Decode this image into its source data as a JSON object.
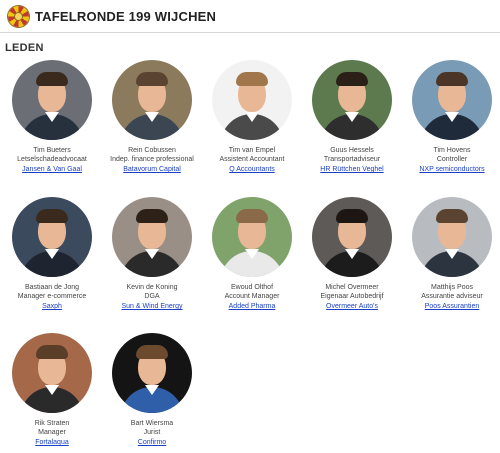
{
  "header": {
    "title": "TAFELRONDE 199 WIJCHEN"
  },
  "section": {
    "title": "LEDEN"
  },
  "members": [
    {
      "name": "Tim Bueters",
      "role": "Letselschadeadvocaat",
      "company": "Jansen & Van Gaal",
      "bg": "#6b6f75",
      "suit": "#27303d",
      "hair": "#3a2a1e"
    },
    {
      "name": "Rein Cobussen",
      "role": "Indep. finance professional",
      "company": "Batavorum Capital",
      "bg": "#8b7a5c",
      "suit": "#3b4652",
      "hair": "#5a4330"
    },
    {
      "name": "Tim van Empel",
      "role": "Assistent Accountant",
      "company": "Q Accountants",
      "bg": "#f2f2f2",
      "suit": "#4a4a4a",
      "hair": "#a0764a"
    },
    {
      "name": "Guus Hessels",
      "role": "Transportadviseur",
      "company": "HR Rüttchen Veghel",
      "bg": "#5c7a4d",
      "suit": "#2e2e2e",
      "hair": "#2b2018"
    },
    {
      "name": "Tim Hovens",
      "role": "Controller",
      "company": "NXP semiconductors",
      "bg": "#7a9bb5",
      "suit": "#1f2a3a",
      "hair": "#4a3526"
    },
    {
      "name": "Bastiaan de Jong",
      "role": "Manager e-commerce",
      "company": "Saxph",
      "bg": "#3b4a5c",
      "suit": "#1e2430",
      "hair": "#3a2a1e"
    },
    {
      "name": "Kevin de Koning",
      "role": "DGA",
      "company": "Sun & Wind Energy",
      "bg": "#9a8f86",
      "suit": "#2a2a2a",
      "hair": "#2e2218"
    },
    {
      "name": "Ewoud Olthof",
      "role": "Account Manager",
      "company": "Added Pharma",
      "bg": "#7fa36a",
      "suit": "#e9e9e9",
      "hair": "#8a6a48"
    },
    {
      "name": "Michel Overmeer",
      "role": "Eigenaar Autobedrijf",
      "company": "Overmeer Auto's",
      "bg": "#5e5a57",
      "suit": "#1c1c1c",
      "hair": "#1e1612"
    },
    {
      "name": "Matthijs Poos",
      "role": "Assurantie adviseur",
      "company": "Poos Assurantien",
      "bg": "#b8bcc0",
      "suit": "#2c3440",
      "hair": "#5a4330"
    },
    {
      "name": "Rik Straten",
      "role": "Manager",
      "company": "Fortalaqua",
      "bg": "#a5694a",
      "suit": "#2a2a2a",
      "hair": "#5a3e28"
    },
    {
      "name": "Bart Wiersma",
      "role": "Jurist",
      "company": "Confirmo",
      "bg": "#141414",
      "suit": "#2f5fa8",
      "hair": "#6b4a2e"
    }
  ]
}
